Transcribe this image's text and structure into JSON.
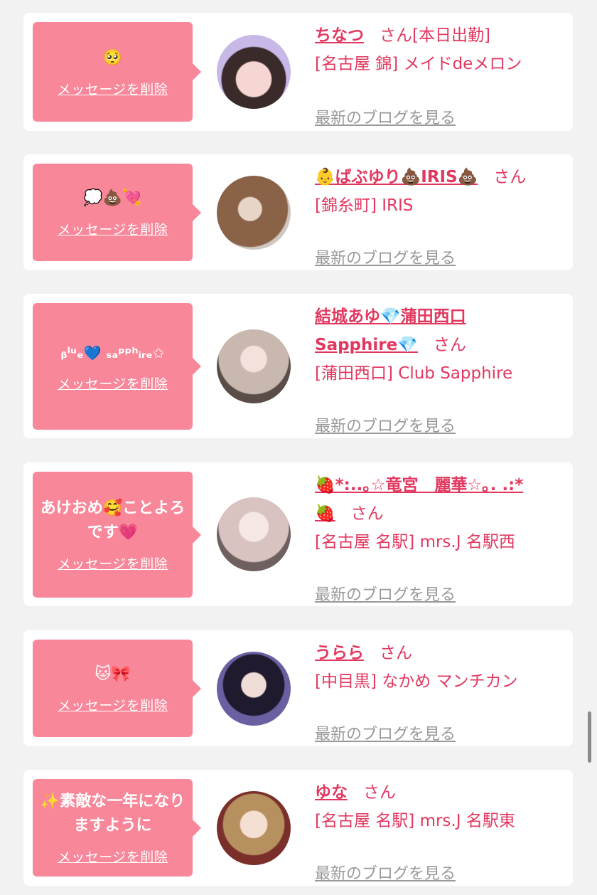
{
  "delete_label": "メッセージを削除",
  "blog_label": "最新のブログを見る",
  "san_label": "さん",
  "cards": [
    {
      "message": "🥺",
      "name": "ちなつ",
      "suffix": "さん[本日出勤]",
      "shop": "[名古屋 錦] メイドdeメロン"
    },
    {
      "message": "💭💩💘",
      "name": "👶ばぶゆり💩IRIS💩",
      "shop": "[錦糸町] IRIS"
    },
    {
      "message": "ᵦˡᵘₑ💙 ₛₐᵖᵖʰᵢᵣₑ✩",
      "name_line1": "結城あゆ💎蒲田西口",
      "name_line2": "Sapphire💎",
      "shop": "[蒲田西口] Club Sapphire"
    },
    {
      "message": "あけおめ🥰ことよろです💗",
      "name_line1": "🍓*:..｡☆竜宮　麗華☆｡. .:*",
      "name_line2": "🍓",
      "shop": "[名古屋 名駅] mrs.J 名駅西"
    },
    {
      "message": "🐱🎀",
      "name": "うらら",
      "shop": "[中目黒] なかめ マンチカン"
    },
    {
      "message": "✨素敵な一年になりますように",
      "name": "ゆな",
      "shop": "[名古屋 名駅] mrs.J 名駅東"
    }
  ],
  "colors": {
    "accent": "#e2385f",
    "bubble": "#f9879a",
    "link_gray": "#999999",
    "background": "#f2f2f3"
  }
}
